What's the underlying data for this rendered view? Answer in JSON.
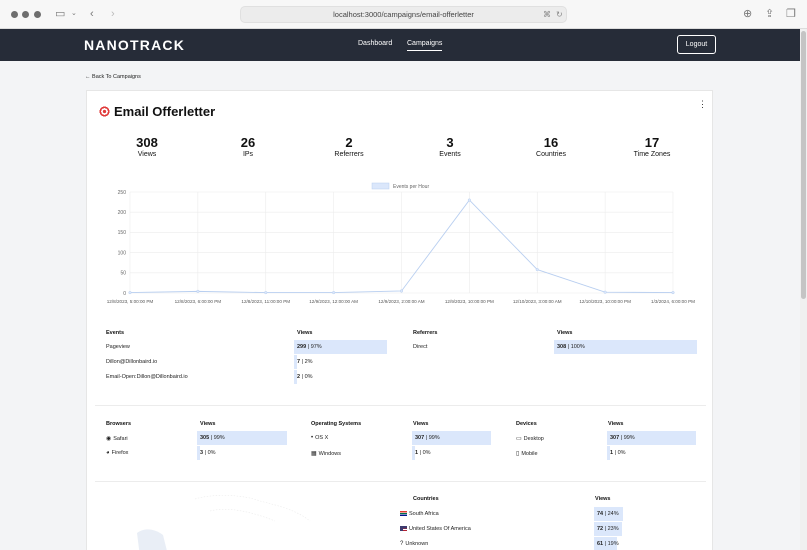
{
  "browser": {
    "url": "localhost:3000/campaigns/email-offerletter"
  },
  "nav": {
    "logo": "NANOTRACK",
    "links": [
      "Dashboard",
      "Campaigns"
    ],
    "logout": "Logout"
  },
  "back": "← Back To Campaigns",
  "campaign": {
    "title": "Email Offerletter"
  },
  "stats": [
    {
      "value": "308",
      "label": "Views"
    },
    {
      "value": "26",
      "label": "IPs"
    },
    {
      "value": "2",
      "label": "Referrers"
    },
    {
      "value": "3",
      "label": "Events"
    },
    {
      "value": "16",
      "label": "Countries"
    },
    {
      "value": "17",
      "label": "Time Zones"
    }
  ],
  "chart_data": {
    "type": "line",
    "legend": "Events per Hour",
    "legend_position": "top-center",
    "grid": true,
    "ylim": [
      0,
      250
    ],
    "yticks": [
      "250",
      "200",
      "150",
      "100",
      "50",
      "0"
    ],
    "x": [
      "12/8/2023, 5:00:00 PM",
      "12/8/2023, 6:00:00 PM",
      "12/8/2023, 11:00:00 PM",
      "12/9/2023, 12:00:00 AM",
      "12/9/2023, 2:00:00 AM",
      "12/9/2023, 10:00:00 PM",
      "12/10/2023, 3:00:00 AM",
      "12/10/2023, 10:00:00 PM",
      "1/3/2024, 6:00:00 PM"
    ],
    "values": [
      1,
      4,
      1,
      1,
      5,
      230,
      58,
      2,
      1
    ]
  },
  "events": {
    "headers": [
      "Events",
      "Views"
    ],
    "rows": [
      {
        "name": "Pageview",
        "count": "299",
        "pct": "97%",
        "frac": 0.97
      },
      {
        "name": "Dillon@Dillonbaird.io",
        "count": "7",
        "pct": "2%",
        "frac": 0.02
      },
      {
        "name": "Email-Open:Dillon@Dillonbaird.io",
        "count": "2",
        "pct": "0%",
        "frac": 0.0
      }
    ]
  },
  "referrers": {
    "headers": [
      "Referrers",
      "Views"
    ],
    "rows": [
      {
        "name": "Direct",
        "count": "308",
        "pct": "100%",
        "frac": 1.0
      }
    ]
  },
  "browsers": {
    "headers": [
      "Browsers",
      "Views"
    ],
    "rows": [
      {
        "name": "Safari",
        "icon": "safari-icon",
        "count": "305",
        "pct": "99%",
        "frac": 0.99
      },
      {
        "name": "Firefox",
        "icon": "firefox-icon",
        "count": "3",
        "pct": "0%",
        "frac": 0.0
      }
    ]
  },
  "os": {
    "headers": [
      "Operating Systems",
      "Views"
    ],
    "rows": [
      {
        "name": "OS X",
        "icon": "apple-icon",
        "count": "307",
        "pct": "99%",
        "frac": 0.99
      },
      {
        "name": "Windows",
        "icon": "windows-icon",
        "count": "1",
        "pct": "0%",
        "frac": 0.0
      }
    ]
  },
  "devices": {
    "headers": [
      "Devices",
      "Views"
    ],
    "rows": [
      {
        "name": "Desktop",
        "icon": "desktop-icon",
        "count": "307",
        "pct": "99%",
        "frac": 0.99
      },
      {
        "name": "Mobile",
        "icon": "mobile-icon",
        "count": "1",
        "pct": "0%",
        "frac": 0.0
      }
    ]
  },
  "countries": {
    "headers": [
      "Countries",
      "Views"
    ],
    "rows": [
      {
        "name": "South Africa",
        "icon": "south-africa-flag-icon",
        "count": "74",
        "pct": "24%",
        "frac": 0.24
      },
      {
        "name": "United States Of America",
        "icon": "usa-flag-icon",
        "count": "72",
        "pct": "23%",
        "frac": 0.23
      },
      {
        "name": "Unknown",
        "icon": "question-icon",
        "count": "61",
        "pct": "19%",
        "frac": 0.19
      }
    ]
  },
  "colors": {
    "nav_bg": "#262c38",
    "bar_fill": "#dbe7fb",
    "line": "#b9cff0"
  }
}
